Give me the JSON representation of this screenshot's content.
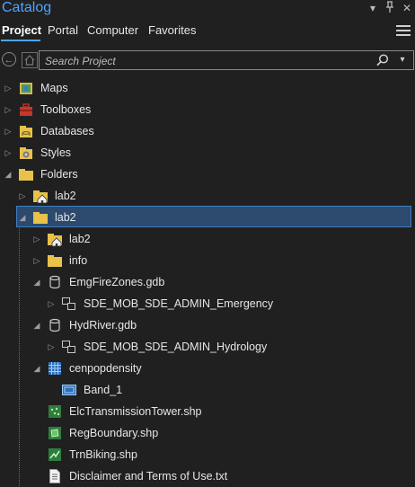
{
  "header": {
    "title": "Catalog",
    "dropdown_glyph": "▾",
    "pin_glyph": "⊥",
    "close_glyph": "✕"
  },
  "tabs": [
    {
      "label": "Project",
      "active": true
    },
    {
      "label": "Portal",
      "active": false
    },
    {
      "label": "Computer",
      "active": false
    },
    {
      "label": "Favorites",
      "active": false
    }
  ],
  "search": {
    "placeholder": "Search Project",
    "back_glyph": "←",
    "dropdown_glyph": "▾"
  },
  "tree": [
    {
      "label": "Maps",
      "icon": "maps-icon",
      "expanded": false
    },
    {
      "label": "Toolboxes",
      "icon": "toolbox-icon",
      "expanded": false
    },
    {
      "label": "Databases",
      "icon": "database-icon",
      "expanded": false
    },
    {
      "label": "Styles",
      "icon": "styles-icon",
      "expanded": false
    },
    {
      "label": "Folders",
      "icon": "folder-icon",
      "expanded": true
    },
    {
      "label": "lab2",
      "icon": "home-folder-icon",
      "expanded": false
    },
    {
      "label": "lab2",
      "icon": "folder-icon",
      "expanded": true,
      "selected": true
    },
    {
      "label": "lab2",
      "icon": "home-folder-icon",
      "expanded": false
    },
    {
      "label": "info",
      "icon": "folder-icon",
      "expanded": false
    },
    {
      "label": "EmgFireZones.gdb",
      "icon": "geodatabase-icon",
      "expanded": true
    },
    {
      "label": "SDE_MOB_SDE_ADMIN_Emergency",
      "icon": "feature-dataset-icon",
      "expanded": false
    },
    {
      "label": "HydRiver.gdb",
      "icon": "geodatabase-icon",
      "expanded": true
    },
    {
      "label": "SDE_MOB_SDE_ADMIN_Hydrology",
      "icon": "feature-dataset-icon",
      "expanded": false
    },
    {
      "label": "cenpopdensity",
      "icon": "raster-icon",
      "expanded": true
    },
    {
      "label": "Band_1",
      "icon": "raster-band-icon"
    },
    {
      "label": "ElcTransmissionTower.shp",
      "icon": "point-shapefile-icon"
    },
    {
      "label": "RegBoundary.shp",
      "icon": "polygon-shapefile-icon"
    },
    {
      "label": "TrnBiking.shp",
      "icon": "line-shapefile-icon"
    },
    {
      "label": "Disclaimer and Terms of Use.txt",
      "icon": "text-file-icon"
    }
  ],
  "glyphs": {
    "collapsed": "▷",
    "expanded": "◢"
  }
}
